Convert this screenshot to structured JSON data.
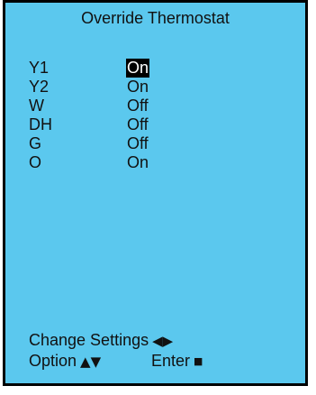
{
  "screen": {
    "title": "Override Thermostat",
    "background_color": "#5bc8ee"
  },
  "rows": [
    {
      "label": "Y1",
      "value": "On",
      "selected": true
    },
    {
      "label": "Y2",
      "value": "On",
      "selected": false
    },
    {
      "label": "W",
      "value": "Off",
      "selected": false
    },
    {
      "label": "DH",
      "value": "Off",
      "selected": false
    },
    {
      "label": "G",
      "value": "Off",
      "selected": false
    },
    {
      "label": "O",
      "value": "On",
      "selected": false
    }
  ],
  "footer": {
    "change_settings_label": "Change Settings",
    "change_settings_icon": "◀▶",
    "option_label": "Option",
    "option_icon": "▲▼",
    "enter_label": "Enter",
    "enter_icon": "■"
  }
}
